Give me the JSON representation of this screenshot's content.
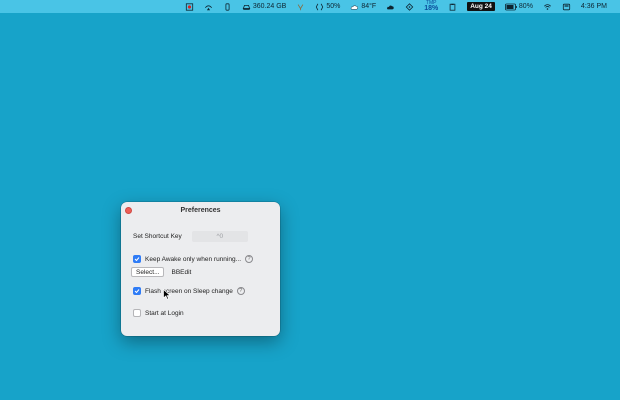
{
  "menubar": {
    "disk": "360.24 GB",
    "battery_percent": "50%",
    "weather": "84°F",
    "temp_top": "TMP",
    "temp_value": "18%",
    "date": "Aug 24",
    "battery_level": "80%",
    "time": "4:36 PM"
  },
  "window": {
    "title": "Preferences",
    "shortcut_label": "Set Shortcut Key",
    "shortcut_value": "^0",
    "keep_awake_label": "Keep Awake only when running...",
    "help_glyph": "?",
    "select_label": "Select...",
    "selected_app": "BBEdit",
    "flash_label": "Flash screen on Sleep change",
    "login_label": "Start at Login"
  },
  "colors": {
    "desktop": "#17a3c9",
    "menubar": "#49c4e6",
    "accent": "#2f7cf6",
    "close": "#ee5e57"
  }
}
